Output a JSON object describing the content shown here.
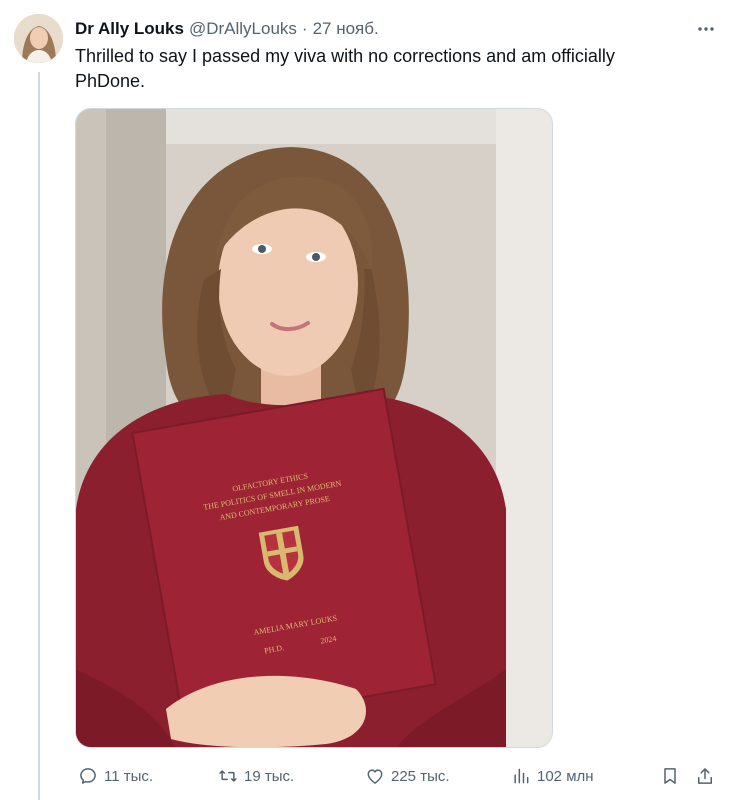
{
  "tweet": {
    "author_name": "Dr Ally Louks",
    "handle": "@DrAllyLouks",
    "separator": "·",
    "date": "27 нояб.",
    "text": "Thrilled to say I passed my viva with no corrections and am officially PhDone."
  },
  "photo": {
    "book_title_line1": "OLFACTORY ETHICS",
    "book_title_line2": "THE POLITICS OF SMELL IN MODERN",
    "book_title_line3": "AND CONTEMPORARY PROSE",
    "book_author": "AMELIA MARY LOUKS",
    "book_degree": "PH.D.",
    "book_year": "2024"
  },
  "actions": {
    "replies": "11 тыс.",
    "retweets": "19 тыс.",
    "likes": "225 тыс.",
    "views": "102 млн"
  },
  "icons": {
    "more": "more-dots-icon",
    "reply": "reply-icon",
    "retweet": "retweet-icon",
    "like": "heart-icon",
    "views": "views-chart-icon",
    "bookmark": "bookmark-icon",
    "share": "share-icon"
  },
  "colors": {
    "text_primary": "#0f1419",
    "text_secondary": "#536471",
    "border": "#cfd9de",
    "book_red": "#9e2435",
    "sweater_red": "#8c1f2e"
  }
}
